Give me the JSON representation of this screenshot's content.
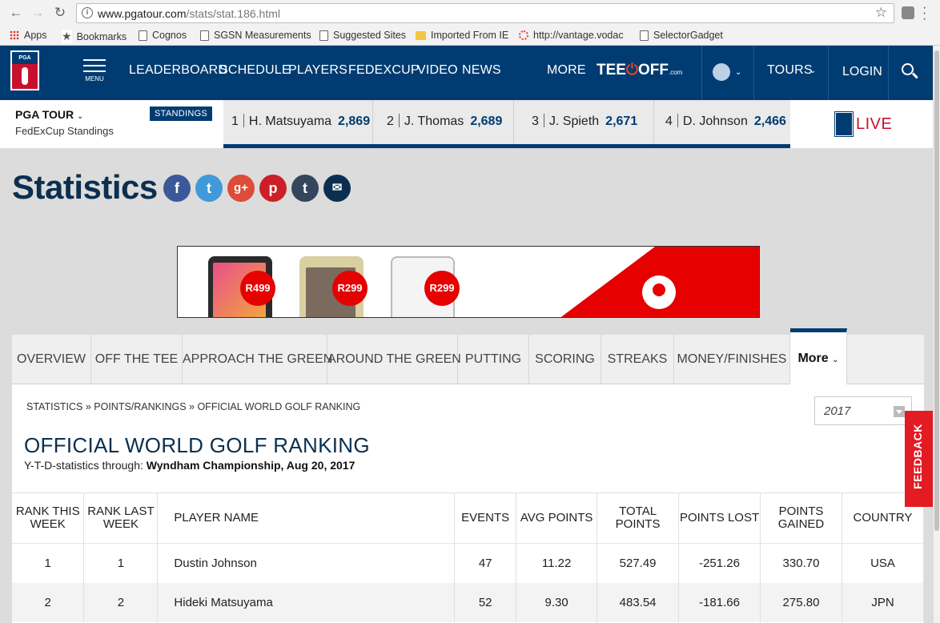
{
  "browser": {
    "url_host": "www.pgatour.com",
    "url_path": "/stats/stat.186.html",
    "bookmarks": [
      {
        "label": "Apps",
        "icon": "apps-grid-icon"
      },
      {
        "label": "Bookmarks",
        "icon": "star-icon"
      },
      {
        "label": "Cognos",
        "icon": "page-icon"
      },
      {
        "label": "SGSN Measurements",
        "icon": "page-icon"
      },
      {
        "label": "Suggested Sites",
        "icon": "page-icon"
      },
      {
        "label": "Imported From IE",
        "icon": "folder-icon"
      },
      {
        "label": "http://vantage.vodac",
        "icon": "loading-icon"
      },
      {
        "label": "SelectorGadget",
        "icon": "page-icon"
      }
    ]
  },
  "header": {
    "menu_label": "MENU",
    "nav": [
      "LEADERBOARD",
      "SCHEDULE",
      "PLAYERS",
      "FEDEXCUP",
      "VIDEO",
      "NEWS"
    ],
    "more": "MORE",
    "teeoff": {
      "pre": "TEE",
      "post": "OFF",
      "suffix": ".com"
    },
    "tours": "TOURS",
    "login": "LOGIN"
  },
  "standings": {
    "tour": "PGA TOUR",
    "subtitle": "FedExCup Standings",
    "badge": "STANDINGS",
    "items": [
      {
        "rank": "1",
        "name": "H. Matsuyama",
        "points": "2,869"
      },
      {
        "rank": "2",
        "name": "J. Thomas",
        "points": "2,689"
      },
      {
        "rank": "3",
        "name": "J. Spieth",
        "points": "2,671"
      },
      {
        "rank": "4",
        "name": "D. Johnson",
        "points": "2,466"
      }
    ],
    "live": "LIVE"
  },
  "page": {
    "title": "Statistics",
    "social": [
      {
        "icon": "facebook-icon",
        "glyph": "f",
        "color": "#3b5998"
      },
      {
        "icon": "twitter-icon",
        "glyph": "t",
        "color": "#4099d8"
      },
      {
        "icon": "google-plus-icon",
        "glyph": "g+",
        "color": "#dd4b39"
      },
      {
        "icon": "pinterest-icon",
        "glyph": "p",
        "color": "#cb2027"
      },
      {
        "icon": "tumblr-icon",
        "glyph": "t",
        "color": "#35465c"
      },
      {
        "icon": "email-icon",
        "glyph": "✉",
        "color": "#0b2f4f"
      }
    ]
  },
  "ad": {
    "prices": [
      "R499",
      "R299",
      "R299"
    ]
  },
  "tabs": [
    "OVERVIEW",
    "OFF THE TEE",
    "APPROACH THE GREEN",
    "AROUND THE GREEN",
    "PUTTING",
    "SCORING",
    "STREAKS",
    "MONEY/FINISHES",
    "More"
  ],
  "stat": {
    "breadcrumb": "STATISTICS » POINTS/RANKINGS » OFFICIAL WORLD GOLF RANKING",
    "year": "2017",
    "title": "OFFICIAL WORLD GOLF RANKING",
    "through_label": "Y-T-D-statistics through:",
    "through_value": "Wyndham Championship, Aug 20, 2017",
    "columns": [
      "RANK THIS WEEK",
      "RANK LAST WEEK",
      "PLAYER NAME",
      "EVENTS",
      "AVG POINTS",
      "TOTAL POINTS",
      "POINTS LOST",
      "POINTS GAINED",
      "COUNTRY"
    ],
    "rows": [
      [
        "1",
        "1",
        "Dustin Johnson",
        "47",
        "11.22",
        "527.49",
        "-251.26",
        "330.70",
        "USA"
      ],
      [
        "2",
        "2",
        "Hideki Matsuyama",
        "52",
        "9.30",
        "483.54",
        "-181.66",
        "275.80",
        "JPN"
      ]
    ]
  },
  "feedback": "FEEDBACK"
}
